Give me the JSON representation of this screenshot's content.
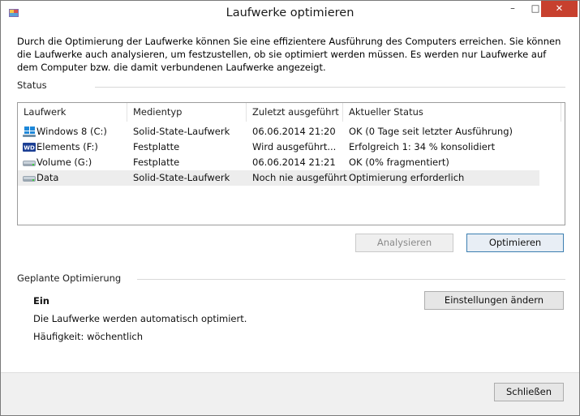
{
  "window": {
    "title": "Laufwerke optimieren",
    "close_glyph": "✕",
    "min_glyph": "–",
    "max_glyph": "□"
  },
  "intro": "Durch die Optimierung der Laufwerke können Sie eine effizientere Ausführung des Computers erreichen. Sie können die Laufwerke auch analysieren, um festzustellen, ob sie optimiert werden müssen. Es werden nur Laufwerke auf dem Computer bzw. die damit verbundenen Laufwerke angezeigt.",
  "status": {
    "label": "Status",
    "columns": [
      "Laufwerk",
      "Medientyp",
      "Zuletzt ausgeführt",
      "Aktueller Status"
    ],
    "rows": [
      {
        "icon": "windows-drive-icon",
        "drive": "Windows 8 (C:)",
        "media": "Solid-State-Laufwerk",
        "last": "06.06.2014 21:20",
        "state": "OK (0 Tage seit letzter Ausführung)"
      },
      {
        "icon": "wd-drive-icon",
        "drive": "Elements (F:)",
        "media": "Festplatte",
        "last": "Wird ausgeführt...",
        "state": "Erfolgreich 1: 34 % konsolidiert"
      },
      {
        "icon": "hard-drive-icon",
        "drive": "Volume (G:)",
        "media": "Festplatte",
        "last": "06.06.2014 21:21",
        "state": "OK (0% fragmentiert)"
      },
      {
        "icon": "hard-drive-icon",
        "drive": "Data",
        "media": "Solid-State-Laufwerk",
        "last": "Noch nie ausgeführt",
        "state": "Optimierung erforderlich"
      }
    ],
    "analyze_label": "Analysieren",
    "optimize_label": "Optimieren"
  },
  "schedule": {
    "label": "Geplante Optimierung",
    "state": "Ein",
    "description": "Die Laufwerke werden automatisch optimiert.",
    "frequency": "Häufigkeit: wöchentlich",
    "change_settings_label": "Einstellungen ändern"
  },
  "footer": {
    "close_label": "Schließen"
  },
  "colors": {
    "close_button": "#c7402e",
    "selected_row": "#ededed",
    "accent_border": "#3c7fb1"
  }
}
